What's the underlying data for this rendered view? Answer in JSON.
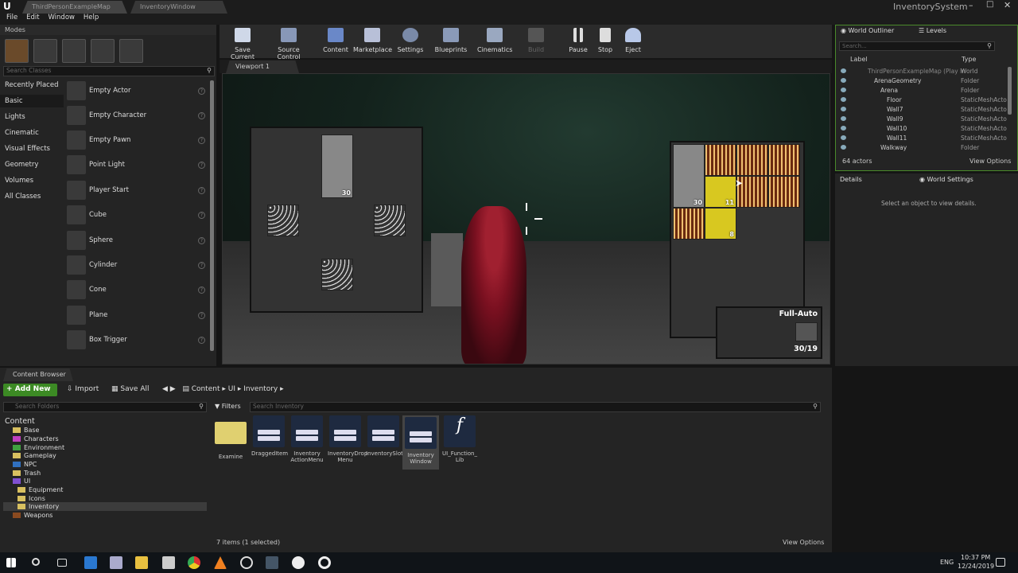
{
  "window": {
    "tabs": [
      "ThirdPersonExampleMap",
      "InventoryWindow"
    ],
    "title": "InventorySystem"
  },
  "menu": [
    "File",
    "Edit",
    "Window",
    "Help"
  ],
  "modes": {
    "title": "Modes",
    "search_placeholder": "Search Classes",
    "categories": [
      "Recently Placed",
      "Basic",
      "Lights",
      "Cinematic",
      "Visual Effects",
      "Geometry",
      "Volumes",
      "All Classes"
    ],
    "items": [
      "Empty Actor",
      "Empty Character",
      "Empty Pawn",
      "Point Light",
      "Player Start",
      "Cube",
      "Sphere",
      "Cylinder",
      "Cone",
      "Plane",
      "Box Trigger"
    ]
  },
  "toolbar": [
    "Save Current",
    "Source Control",
    "Content",
    "Marketplace",
    "Settings",
    "Blueprints",
    "Cinematics",
    "Build",
    "Pause",
    "Stop",
    "Eject"
  ],
  "viewport": {
    "tab": "Viewport 1",
    "slot_count": "30",
    "inventory_counts": [
      "30",
      "11",
      "8"
    ],
    "weapon_mode": "Full-Auto",
    "weapon_ammo": "30/19"
  },
  "outliner": {
    "tab": "World Outliner",
    "tab2": "Levels",
    "search_placeholder": "Search...",
    "col_label": "Label",
    "col_type": "Type",
    "rows": [
      [
        "ThirdPersonExampleMap (Play in",
        "World"
      ],
      [
        "ArenaGeometry",
        "Folder"
      ],
      [
        "Arena",
        "Folder"
      ],
      [
        "Floor",
        "StaticMeshActo"
      ],
      [
        "Wall7",
        "StaticMeshActo"
      ],
      [
        "Wall9",
        "StaticMeshActo"
      ],
      [
        "Wall10",
        "StaticMeshActo"
      ],
      [
        "Wall11",
        "StaticMeshActo"
      ],
      [
        "Walkway",
        "Folder"
      ]
    ],
    "count": "64 actors",
    "view_options": "View Options"
  },
  "details": {
    "tab": "Details",
    "tab2": "World Settings",
    "empty": "Select an object to view details."
  },
  "content_browser": {
    "tab": "Content Browser",
    "add_new": "Add New",
    "import": "Import",
    "save_all": "Save All",
    "path": [
      "Content",
      "UI",
      "Inventory"
    ],
    "search_folders": "Search Folders",
    "filters": "Filters",
    "search_assets": "Search Inventory",
    "folders": [
      "Content",
      "Base",
      "Characters",
      "Environment",
      "Gameplay",
      "NPC",
      "Trash",
      "UI",
      "Equipment",
      "Icons",
      "Inventory",
      "Weapons"
    ],
    "assets": [
      "Examine",
      "DraggedItem",
      "Inventory ActionMenu",
      "InventoryDrop Menu",
      "InventorySlot",
      "Inventory Window",
      "UI_Function_ Lib"
    ],
    "status": "7 items (1 selected)",
    "view_options": "View Options"
  },
  "taskbar": {
    "lang": "ENG",
    "time": "10:37 PM",
    "date": "12/24/2019"
  }
}
